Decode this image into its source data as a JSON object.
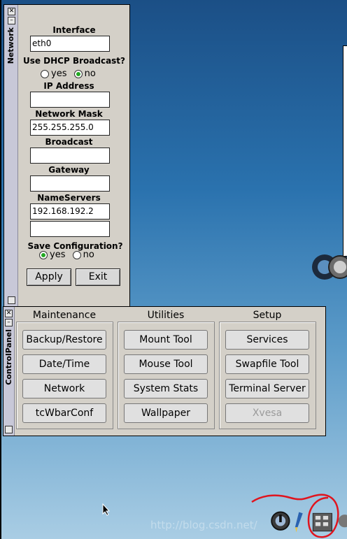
{
  "network": {
    "title": "Network",
    "interface_label": "Interface",
    "interface_value": "eth0",
    "dhcp_label": "Use DHCP Broadcast?",
    "dhcp_yes": "yes",
    "dhcp_no": "no",
    "dhcp_selected": "no",
    "ip_label": "IP Address",
    "ip_value": "",
    "mask_label": "Network Mask",
    "mask_value": "255.255.255.0",
    "broadcast_label": "Broadcast",
    "broadcast_value": "",
    "gateway_label": "Gateway",
    "gateway_value": "",
    "ns_label": "NameServers",
    "ns1_value": "192.168.192.2",
    "ns2_value": "",
    "save_label": "Save Configuration?",
    "save_yes": "yes",
    "save_no": "no",
    "save_selected": "yes",
    "apply_label": "Apply",
    "exit_label": "Exit"
  },
  "controlpanel": {
    "title": "ControlPanel",
    "maintenance": {
      "title": "Maintenance",
      "items": [
        "Backup/Restore",
        "Date/Time",
        "Network",
        "tcWbarConf"
      ]
    },
    "utilities": {
      "title": "Utilities",
      "items": [
        "Mount Tool",
        "Mouse Tool",
        "System Stats",
        "Wallpaper"
      ]
    },
    "setup": {
      "title": "Setup",
      "items": [
        "Services",
        "Swapfile Tool",
        "Terminal Server",
        "Xvesa"
      ],
      "disabled": [
        "Xvesa"
      ]
    }
  },
  "colors": {
    "window_bg": "#d4d0c8",
    "radio_selected": "#22a822",
    "annotation_red": "#e0141e"
  },
  "icons": [
    "close-icon",
    "minimize-icon",
    "wbar-logo-icon",
    "mouse-cursor-icon",
    "power-icon",
    "paintbrush-icon",
    "control-panel-icon"
  ],
  "desktop": {
    "watermark": "http://blog.csdn.net/"
  }
}
